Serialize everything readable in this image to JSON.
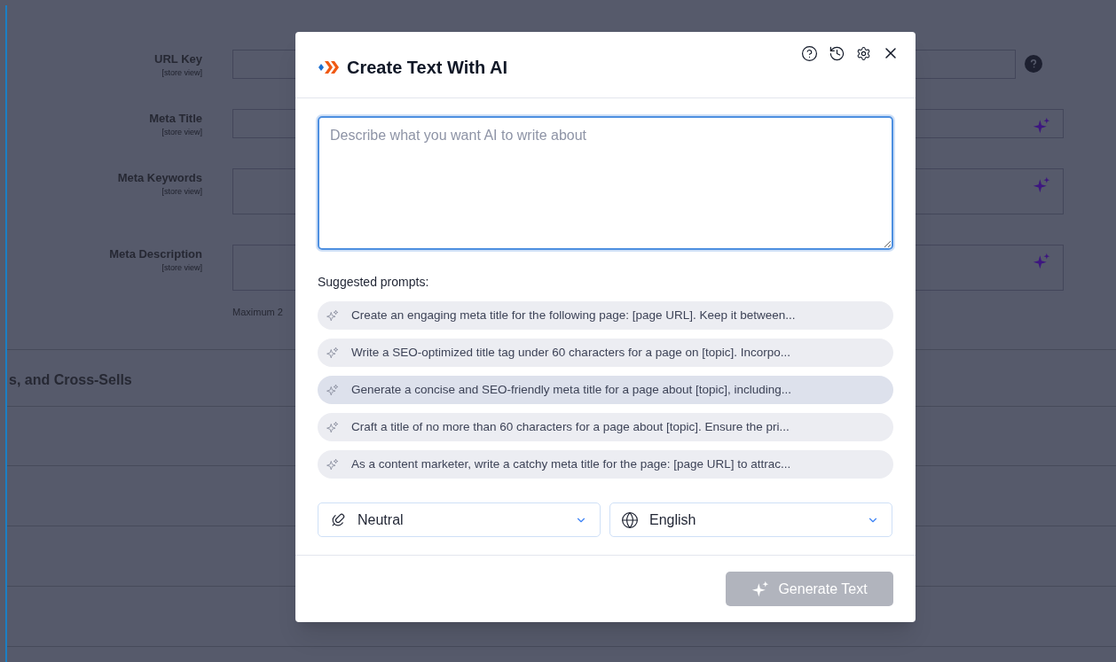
{
  "background": {
    "fields": [
      {
        "label": "URL Key",
        "scope": "[store view]",
        "kind": "help"
      },
      {
        "label": "Meta Title",
        "scope": "[store view]",
        "kind": "aiinput"
      },
      {
        "label": "Meta Keywords",
        "scope": "[store view]",
        "kind": "aiarea"
      },
      {
        "label": "Meta Description",
        "scope": "[store view]",
        "kind": "aiarea"
      }
    ],
    "note": "Maximum 2",
    "section_title": "s, and Cross-Sells"
  },
  "dialog": {
    "title": "Create Text With AI",
    "prompt_field": {
      "placeholder": "Describe what you want AI to write about"
    },
    "suggested_label": "Suggested prompts:",
    "prompts": [
      {
        "text": "Create an engaging meta title for the following page: [page URL]. Keep it between...",
        "selected": false
      },
      {
        "text": "Write a SEO-optimized title tag under 60 characters for a page on [topic]. Incorpo...",
        "selected": false
      },
      {
        "text": "Generate a concise and SEO-friendly meta title for a page about [topic], including...",
        "selected": true
      },
      {
        "text": "Craft a title of no more than 60 characters for a page about [topic]. Ensure the pri...",
        "selected": false
      },
      {
        "text": "As a content marketer, write a catchy meta title for the page: [page URL] to attrac...",
        "selected": false
      }
    ],
    "selects": [
      {
        "kind": "tone",
        "value": "Neutral"
      },
      {
        "kind": "language",
        "value": "English"
      }
    ],
    "generate_button": {
      "label": "Generate Text",
      "disabled": true
    }
  }
}
